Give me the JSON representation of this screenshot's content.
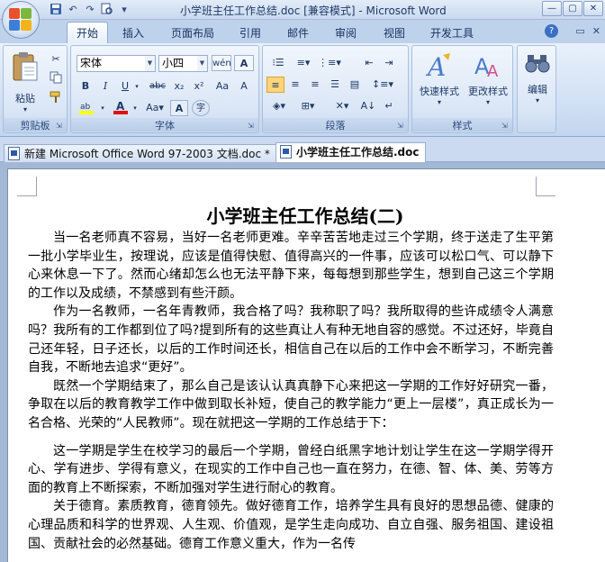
{
  "window": {
    "title": "小学班主任工作总结.doc [兼容模式] - Microsoft Word",
    "controls": [
      "—",
      "▢",
      "✕"
    ]
  },
  "quick_access": [
    "save-icon",
    "undo-icon",
    "redo-icon",
    "print-preview-icon",
    "customize-icon"
  ],
  "tabs": [
    {
      "label": "开始",
      "active": true
    },
    {
      "label": "插入"
    },
    {
      "label": "页面布局"
    },
    {
      "label": "引用"
    },
    {
      "label": "邮件"
    },
    {
      "label": "审阅"
    },
    {
      "label": "视图"
    },
    {
      "label": "开发工具"
    }
  ],
  "ribbon": {
    "clipboard": {
      "label": "剪贴板",
      "paste": "粘贴"
    },
    "font": {
      "label": "字体",
      "font_name": "宋体",
      "font_size": "小四"
    },
    "paragraph": {
      "label": "段落"
    },
    "styles": {
      "label": "样式",
      "quick_styles": "快速样式",
      "change_styles": "更改样式"
    },
    "editing": {
      "label": "编辑"
    }
  },
  "document_tabs": [
    {
      "label": "新建 Microsoft Office Word 97-2003 文档.doc *",
      "active": false
    },
    {
      "label": "小学班主任工作总结.doc",
      "active": true
    }
  ],
  "document": {
    "title": "小学班主任工作总结(二)",
    "paragraphs": [
      "当一名老师真不容易，当好一名老师更难。辛辛苦苦地走过三个学期，终于送走了生平第一批小学毕业生，按理说，应该是值得快慰、值得高兴的一件事，应该可以松口气、可以静下心来休息一下了。然而心绪却怎么也无法平静下来，每每想到那些学生，想到自己这三个学期的工作以及成绩，不禁感到有些汗颜。",
      "作为一名教师，一名年青教师，我合格了吗？我称职了吗？我所取得的些许成绩令人满意吗？我所有的工作都到位了吗?提到所有的这些真让人有种无地自容的感觉。不过还好，毕竟自己还年轻，日子还长，以后的工作时间还长，相信自己在以后的工作中会不断学习，不断完善自我，不断地去追求“更好”。",
      "既然一个学期结束了，那么自己是该认认真真静下心来把这一学期的工作好好研究一番，争取在以后的教育教学工作中做到取长补短，使自己的教学能力“更上一层楼”，真正成长为一名合格、光荣的“人民教师”。现在就把这一学期的工作总结于下：",
      "这一学期是学生在校学习的最后一个学期，曾经白纸黑字地计划让学生在这一学期学得开心、学有进步、学得有意义，在现实的工作中自己也一直在努力，在德、智、体、美、劳等方面的教育上不断探索，不断加强对学生进行耐心的教育。",
      "关于德育。素质教育，德育领先。做好德育工作，培养学生具有良好的思想品德、健康的心理品质和科学的世界观、人生观、价值观，是学生走向成功、自立自强、服务祖国、建设祖国、贡献社会的必然基础。德育工作意义重大，作为一名传"
    ]
  }
}
